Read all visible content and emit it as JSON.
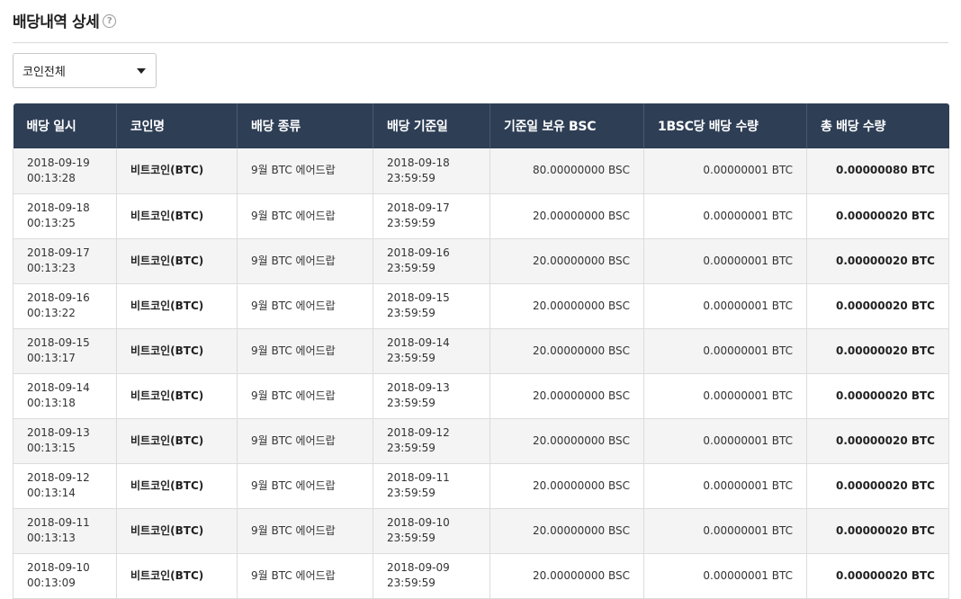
{
  "page": {
    "title": "배당내역 상세",
    "help_glyph": "?"
  },
  "filter": {
    "selected": "코인전체",
    "icon": "chevron-down-icon"
  },
  "table": {
    "columns": [
      "배당 일시",
      "코인명",
      "배당 종류",
      "배당 기준일",
      "기준일 보유 BSC",
      "1BSC당 배당 수량",
      "총 배당 수량"
    ],
    "rows": [
      {
        "date": "2018-09-19",
        "time": "00:13:28",
        "coin": "비트코인(BTC)",
        "type": "9월 BTC 에어드랍",
        "base_date": "2018-09-18",
        "base_time": "23:59:59",
        "holding": "80.00000000 BSC",
        "per_bsc": "0.00000001 BTC",
        "total": "0.00000080 BTC"
      },
      {
        "date": "2018-09-18",
        "time": "00:13:25",
        "coin": "비트코인(BTC)",
        "type": "9월 BTC 에어드랍",
        "base_date": "2018-09-17",
        "base_time": "23:59:59",
        "holding": "20.00000000 BSC",
        "per_bsc": "0.00000001 BTC",
        "total": "0.00000020 BTC"
      },
      {
        "date": "2018-09-17",
        "time": "00:13:23",
        "coin": "비트코인(BTC)",
        "type": "9월 BTC 에어드랍",
        "base_date": "2018-09-16",
        "base_time": "23:59:59",
        "holding": "20.00000000 BSC",
        "per_bsc": "0.00000001 BTC",
        "total": "0.00000020 BTC"
      },
      {
        "date": "2018-09-16",
        "time": "00:13:22",
        "coin": "비트코인(BTC)",
        "type": "9월 BTC 에어드랍",
        "base_date": "2018-09-15",
        "base_time": "23:59:59",
        "holding": "20.00000000 BSC",
        "per_bsc": "0.00000001 BTC",
        "total": "0.00000020 BTC"
      },
      {
        "date": "2018-09-15",
        "time": "00:13:17",
        "coin": "비트코인(BTC)",
        "type": "9월 BTC 에어드랍",
        "base_date": "2018-09-14",
        "base_time": "23:59:59",
        "holding": "20.00000000 BSC",
        "per_bsc": "0.00000001 BTC",
        "total": "0.00000020 BTC"
      },
      {
        "date": "2018-09-14",
        "time": "00:13:18",
        "coin": "비트코인(BTC)",
        "type": "9월 BTC 에어드랍",
        "base_date": "2018-09-13",
        "base_time": "23:59:59",
        "holding": "20.00000000 BSC",
        "per_bsc": "0.00000001 BTC",
        "total": "0.00000020 BTC"
      },
      {
        "date": "2018-09-13",
        "time": "00:13:15",
        "coin": "비트코인(BTC)",
        "type": "9월 BTC 에어드랍",
        "base_date": "2018-09-12",
        "base_time": "23:59:59",
        "holding": "20.00000000 BSC",
        "per_bsc": "0.00000001 BTC",
        "total": "0.00000020 BTC"
      },
      {
        "date": "2018-09-12",
        "time": "00:13:14",
        "coin": "비트코인(BTC)",
        "type": "9월 BTC 에어드랍",
        "base_date": "2018-09-11",
        "base_time": "23:59:59",
        "holding": "20.00000000 BSC",
        "per_bsc": "0.00000001 BTC",
        "total": "0.00000020 BTC"
      },
      {
        "date": "2018-09-11",
        "time": "00:13:13",
        "coin": "비트코인(BTC)",
        "type": "9월 BTC 에어드랍",
        "base_date": "2018-09-10",
        "base_time": "23:59:59",
        "holding": "20.00000000 BSC",
        "per_bsc": "0.00000001 BTC",
        "total": "0.00000020 BTC"
      },
      {
        "date": "2018-09-10",
        "time": "00:13:09",
        "coin": "비트코인(BTC)",
        "type": "9월 BTC 에어드랍",
        "base_date": "2018-09-09",
        "base_time": "23:59:59",
        "holding": "20.00000000 BSC",
        "per_bsc": "0.00000001 BTC",
        "total": "0.00000020 BTC"
      }
    ]
  },
  "colors": {
    "header_bg": "#2e3e55",
    "row_alt_bg": "#f4f4f4"
  }
}
